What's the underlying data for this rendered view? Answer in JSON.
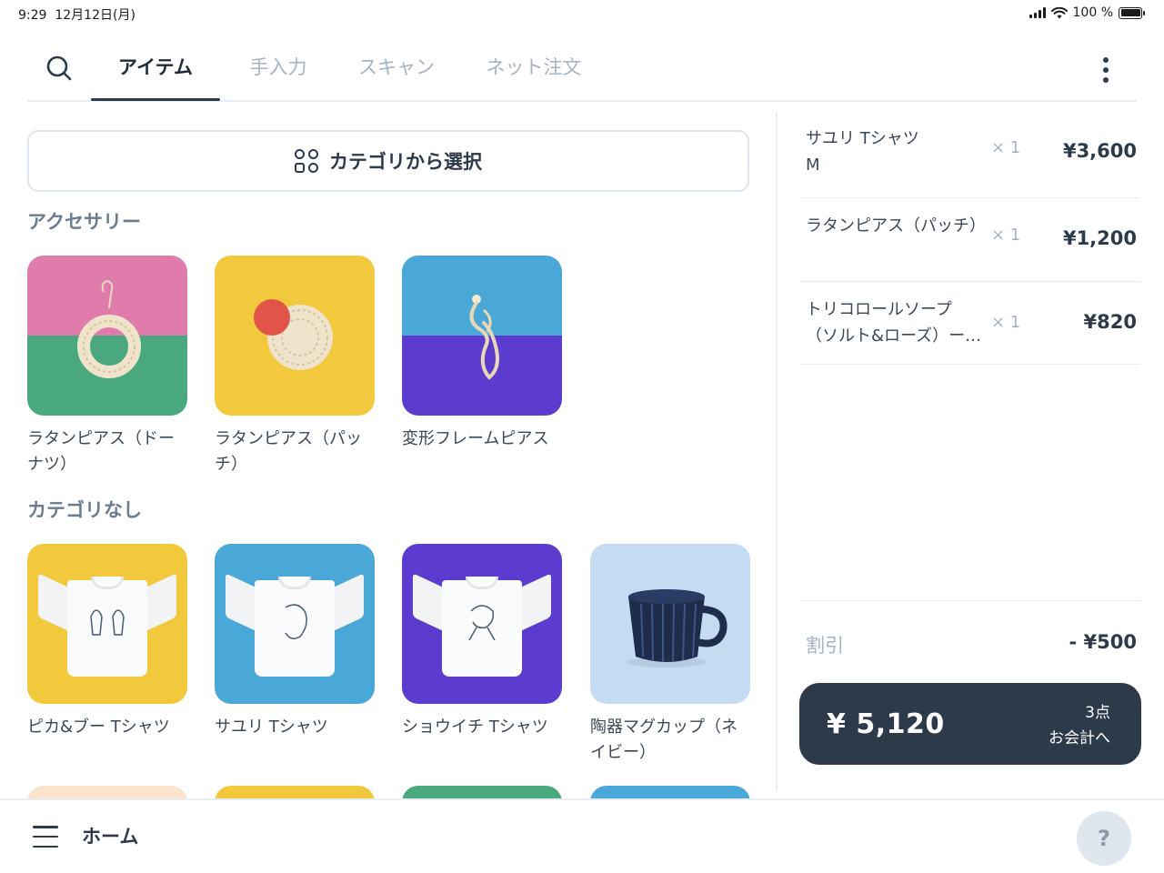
{
  "status_bar": {
    "time": "9:29",
    "date": "12月12日(月)",
    "battery": "100 %",
    "battery_level": 1.0
  },
  "tabs": [
    {
      "label": "アイテム",
      "active": true
    },
    {
      "label": "手入力",
      "active": false
    },
    {
      "label": "スキャン",
      "active": false
    },
    {
      "label": "ネット注文",
      "active": false
    }
  ],
  "category_button": {
    "label": "カテゴリから選択"
  },
  "sections": [
    {
      "title": "アクセサリー",
      "items": [
        {
          "label": "ラタンピアス（ドーナツ）",
          "bg_top": "#e07cab",
          "bg_bottom": "#4aa87f"
        },
        {
          "label": "ラタンピアス（パッチ）",
          "bg": "#f2c93c"
        },
        {
          "label": "変形フレームピアス",
          "bg_top": "#4aa8d8",
          "bg_bottom": "#5b3ccf"
        }
      ]
    },
    {
      "title": "カテゴリなし",
      "items": [
        {
          "label": "ピカ&ブー Tシャツ",
          "bg": "#f2c93c"
        },
        {
          "label": "サユリ Tシャツ",
          "bg": "#4aa8d8"
        },
        {
          "label": "ショウイチ Tシャツ",
          "bg": "#5b3ccf"
        },
        {
          "label": "陶器マグカップ（ネイビー）",
          "bg": "#c5dbf2"
        }
      ]
    }
  ],
  "cart": {
    "items": [
      {
        "name": "サユリ Tシャツ\nM",
        "qty": "× 1",
        "price": "¥3,600"
      },
      {
        "name": "ラタンピアス（パッチ）",
        "qty": "× 1",
        "price": "¥1,200"
      },
      {
        "name": "トリコロールソープ（ソルト&ローズ）ー…",
        "qty": "× 1",
        "price": "¥820"
      }
    ],
    "discount_label": "割引",
    "discount_value": "- ¥500",
    "checkout": {
      "total": "¥ 5,120",
      "count": "3点",
      "label": "お会計へ"
    }
  },
  "bottom_bar": {
    "home_label": "ホーム",
    "help": "?"
  },
  "colors": {
    "primary": "#2d3a4a",
    "muted": "#a7b3c2",
    "border": "#e8edf3"
  }
}
